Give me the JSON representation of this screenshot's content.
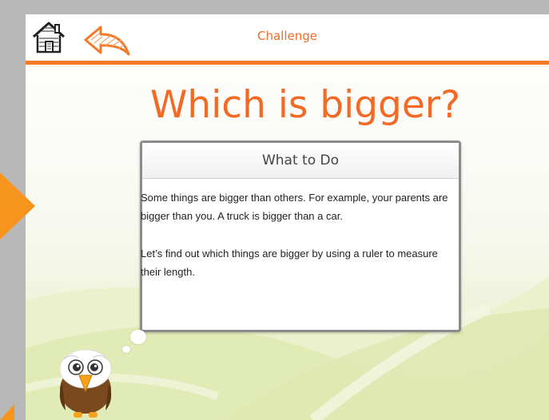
{
  "header": {
    "title": "Challenge",
    "home_icon": "home-icon",
    "back_icon": "back-arrow-icon"
  },
  "page_title": "Which is bigger?",
  "card": {
    "heading": "What to Do",
    "paragraphs": [
      "Some things are bigger than others. For example, your parents are bigger than you. A truck is bigger than a car.",
      "Let’s find out which things are bigger by using a ruler to measure their length."
    ]
  },
  "mascot_icon": "owl-mascot",
  "colors": {
    "accent": "#f47a2a",
    "title": "#f26a24",
    "side_arrow": "#f7941d"
  }
}
